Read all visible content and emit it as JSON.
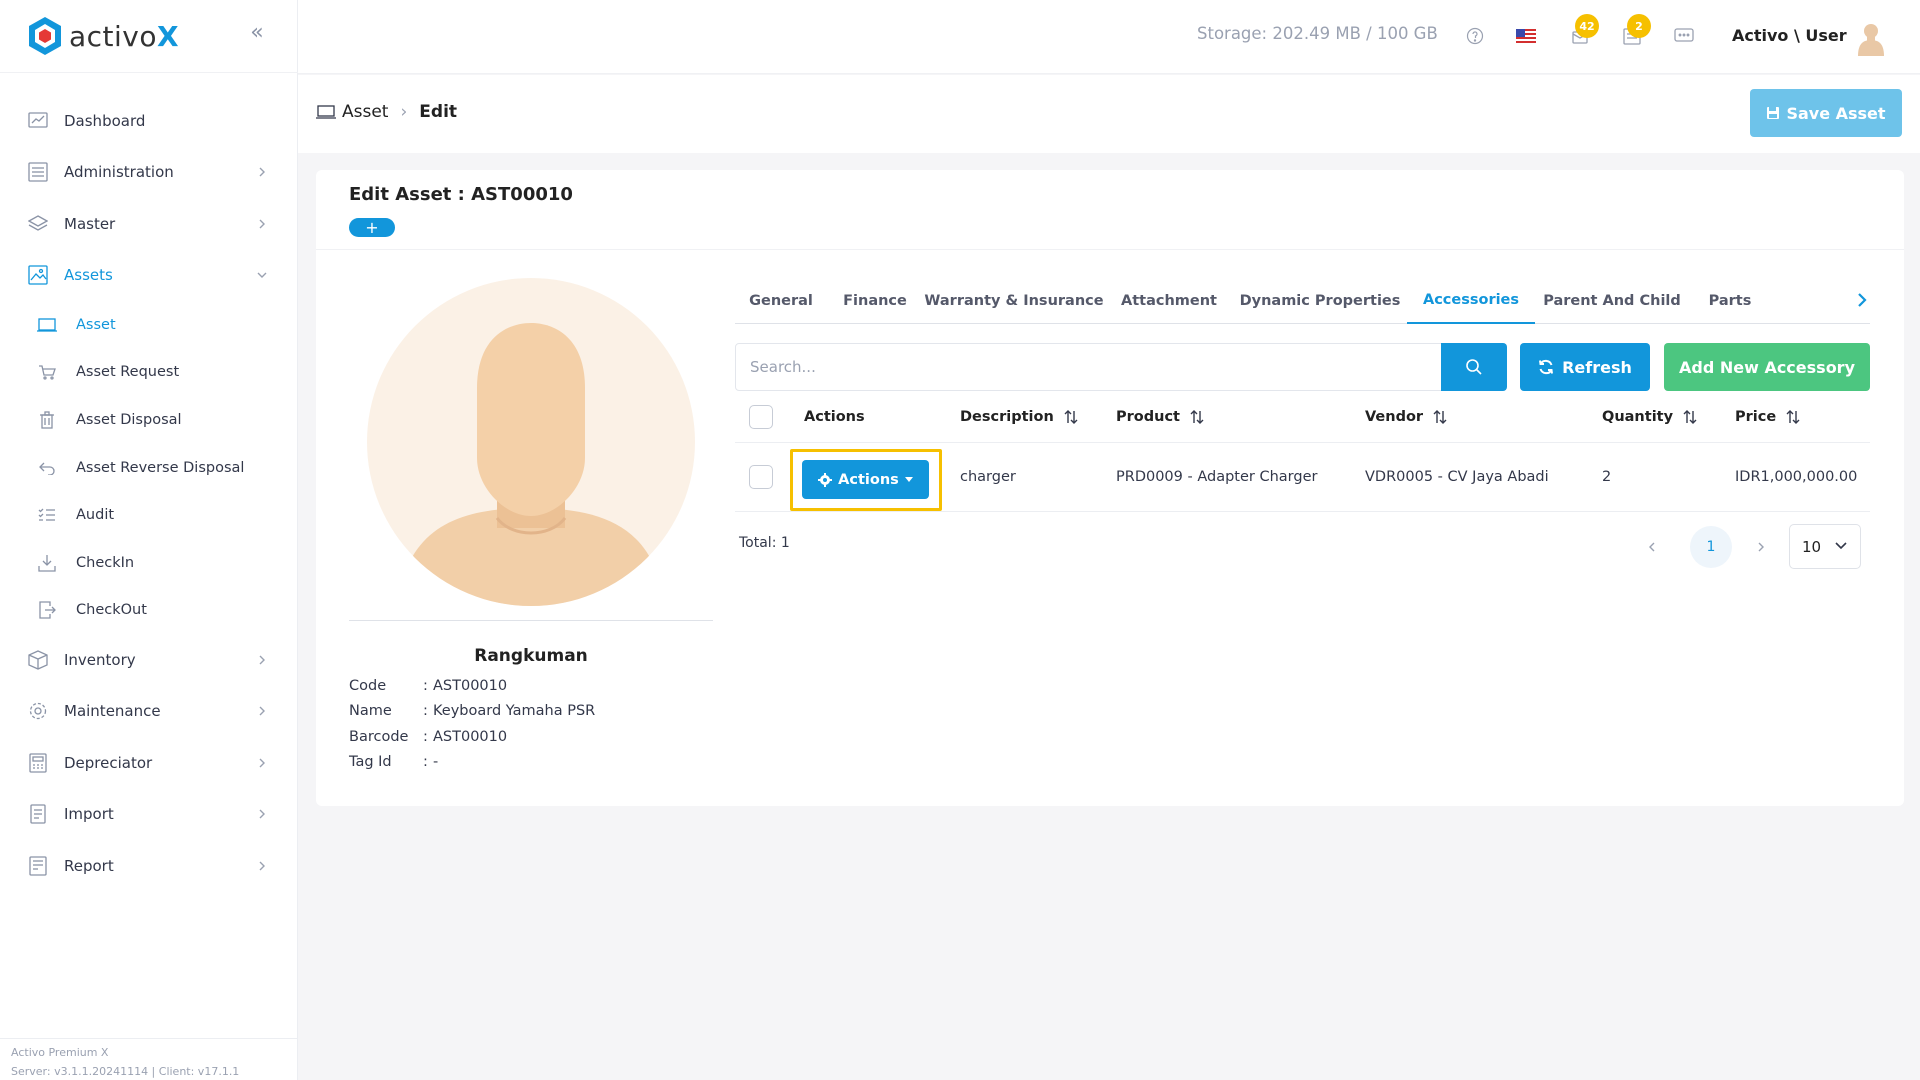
{
  "brand": {
    "name_main": "activo",
    "name_accent": "X"
  },
  "sidebar": {
    "items": [
      {
        "label": "Dashboard",
        "icon": "chart-icon",
        "has_children": false
      },
      {
        "label": "Administration",
        "icon": "list-icon",
        "has_children": true
      },
      {
        "label": "Master",
        "icon": "layers-icon",
        "has_children": true
      },
      {
        "label": "Assets",
        "icon": "image-icon",
        "has_children": true,
        "expanded": true,
        "active": true
      },
      {
        "label": "Inventory",
        "icon": "box-icon",
        "has_children": true
      },
      {
        "label": "Maintenance",
        "icon": "gear-icon",
        "has_children": true
      },
      {
        "label": "Depreciator",
        "icon": "calculator-icon",
        "has_children": true
      },
      {
        "label": "Import",
        "icon": "import-icon",
        "has_children": true
      },
      {
        "label": "Report",
        "icon": "report-icon",
        "has_children": true
      }
    ],
    "assets_children": [
      {
        "label": "Asset",
        "icon": "laptop-icon",
        "active": true
      },
      {
        "label": "Asset Request",
        "icon": "cart-icon"
      },
      {
        "label": "Asset Disposal",
        "icon": "trash-icon"
      },
      {
        "label": "Asset Reverse Disposal",
        "icon": "undo-icon"
      },
      {
        "label": "Audit",
        "icon": "checklist-icon"
      },
      {
        "label": "CheckIn",
        "icon": "download-icon"
      },
      {
        "label": "CheckOut",
        "icon": "export-icon"
      }
    ],
    "footer_line1": "Activo Premium X",
    "footer_line2": "Server: v3.1.1.20241114 | Client: v17.1.1"
  },
  "topbar": {
    "storage": "Storage: 202.49 MB / 100 GB",
    "notifications_badge": "42",
    "tasks_badge": "2",
    "user_name": "Activo \\ User"
  },
  "breadcrumb": {
    "root": "Asset",
    "current": "Edit"
  },
  "save_button": "Save Asset",
  "card": {
    "title": "Edit Asset : AST00010",
    "plus": "+"
  },
  "summary": {
    "title": "Rangkuman",
    "rows": [
      {
        "key": "Code",
        "value": "AST00010"
      },
      {
        "key": "Name",
        "value": "Keyboard Yamaha PSR"
      },
      {
        "key": "Barcode",
        "value": "AST00010"
      },
      {
        "key": "Tag Id",
        "value": "-"
      }
    ]
  },
  "tabs": [
    {
      "label": "General"
    },
    {
      "label": "Finance"
    },
    {
      "label": "Warranty & Insurance"
    },
    {
      "label": "Attachment"
    },
    {
      "label": "Dynamic Properties"
    },
    {
      "label": "Accessories",
      "active": true
    },
    {
      "label": "Parent And Child"
    },
    {
      "label": "Parts"
    }
  ],
  "toolbar": {
    "search_placeholder": "Search...",
    "refresh": "Refresh",
    "add": "Add New Accessory"
  },
  "table": {
    "columns": [
      "Actions",
      "Description",
      "Product",
      "Vendor",
      "Quantity",
      "Price"
    ],
    "rows": [
      {
        "actions": "Actions",
        "description": "charger",
        "product": "PRD0009 - Adapter Charger",
        "vendor": "VDR0005 - CV Jaya Abadi",
        "quantity": "2",
        "price": "IDR1,000,000.00"
      }
    ]
  },
  "pagination": {
    "total": "Total: 1",
    "current_page": "1",
    "page_size": "10"
  },
  "colors": {
    "primary": "#1296db",
    "success": "#4cc680",
    "highlight": "#f6c000",
    "save_disabled": "#6ec3ea"
  }
}
